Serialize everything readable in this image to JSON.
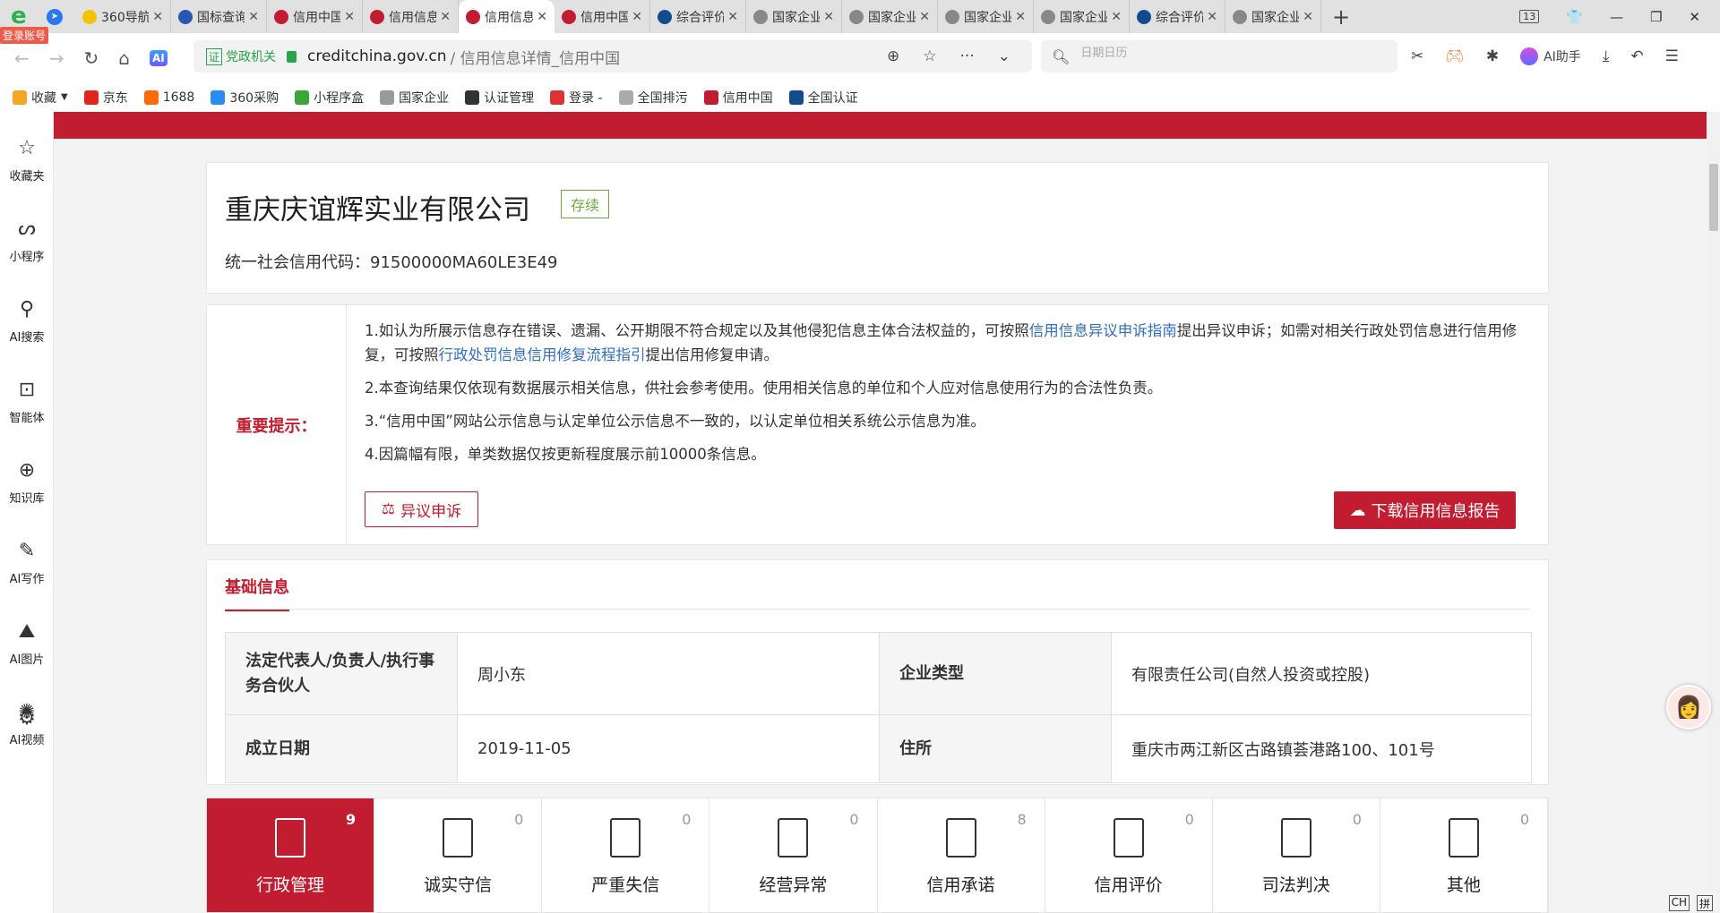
{
  "browser": {
    "login_badge": "登录账号",
    "tabs": [
      {
        "label": "360导航",
        "color": "#f5c400"
      },
      {
        "label": "国标查询",
        "color": "#2756b5"
      },
      {
        "label": "信用中国",
        "color": "#c21c30"
      },
      {
        "label": "信用信息",
        "color": "#c21c30"
      },
      {
        "label": "信用信息",
        "color": "#c21c30",
        "active": true
      },
      {
        "label": "信用中国",
        "color": "#c21c30"
      },
      {
        "label": "综合评价",
        "color": "#114d8e"
      },
      {
        "label": "国家企业",
        "color": "#888888"
      },
      {
        "label": "国家企业",
        "color": "#888888"
      },
      {
        "label": "国家企业",
        "color": "#888888"
      },
      {
        "label": "国家企业",
        "color": "#888888"
      },
      {
        "label": "综合评价",
        "color": "#114d8e"
      },
      {
        "label": "国家企业",
        "color": "#888888"
      }
    ],
    "tab_count": "13",
    "url_badge": "证",
    "url_gov": "党政机关",
    "url_domain": "creditchina.gov.cn",
    "url_path": "/ 信用信息详情_信用中国",
    "search_placeholder": "日期日历",
    "ai_assistant": "AI助手",
    "bookmarks": [
      "收藏",
      "京东",
      "1688",
      "360采购",
      "小程序盒",
      "国家企业",
      "认证管理",
      "登录 -",
      "全国排污",
      "信用中国",
      "全国认证"
    ]
  },
  "sidebar": [
    "收藏夹",
    "小程序",
    "AI搜索",
    "智能体",
    "知识库",
    "AI写作",
    "AI图片",
    "AI视频"
  ],
  "company": {
    "name": "重庆庆谊辉实业有限公司",
    "status": "存续",
    "code_label": "统一社会信用代码：",
    "code": "91500000MA60LE3E49"
  },
  "notice": {
    "label": "重要提示：",
    "p1_a": "1.如认为所展示信息存在错误、遗漏、公开期限不符合规定以及其他侵犯信息主体合法权益的，可按照",
    "p1_link1": "信用信息异议申诉指南",
    "p1_b": "提出异议申诉；如需对相关行政处罚信息进行信用修复，可按照",
    "p1_link2": "行政处罚信息信用修复流程指引",
    "p1_c": "提出信用修复申请。",
    "p2": "2.本查询结果仅依现有数据展示相关信息，供社会参考使用。使用相关信息的单位和个人应对信息使用行为的合法性负责。",
    "p3": "3.“信用中国”网站公示信息与认定单位公示信息不一致的，以认定单位相关系统公示信息为准。",
    "p4": "4.因篇幅有限，单类数据仅按更新程度展示前10000条信息。",
    "appeal_button": "异议申诉",
    "download_button": "下载信用信息报告"
  },
  "basic": {
    "title": "基础信息",
    "rows": [
      [
        {
          "k": "法定代表人/负责人/执行事务合伙人",
          "v": "周小东"
        },
        {
          "k": "企业类型",
          "v": "有限责任公司(自然人投资或控股)"
        }
      ],
      [
        {
          "k": "成立日期",
          "v": "2019-11-05"
        },
        {
          "k": "住所",
          "v": "重庆市两江新区古路镇荟港路100、101号"
        }
      ]
    ]
  },
  "categories": [
    {
      "label": "行政管理",
      "count": "9"
    },
    {
      "label": "诚实守信",
      "count": "0"
    },
    {
      "label": "严重失信",
      "count": "0"
    },
    {
      "label": "经营异常",
      "count": "0"
    },
    {
      "label": "信用承诺",
      "count": "8"
    },
    {
      "label": "信用评价",
      "count": "0"
    },
    {
      "label": "司法判决",
      "count": "0"
    },
    {
      "label": "其他",
      "count": "0"
    }
  ],
  "ime": [
    "CH",
    "拼"
  ],
  "colors": {
    "brand": "#c21c30",
    "link": "#2f6ec3",
    "status": "#6bab3c"
  }
}
